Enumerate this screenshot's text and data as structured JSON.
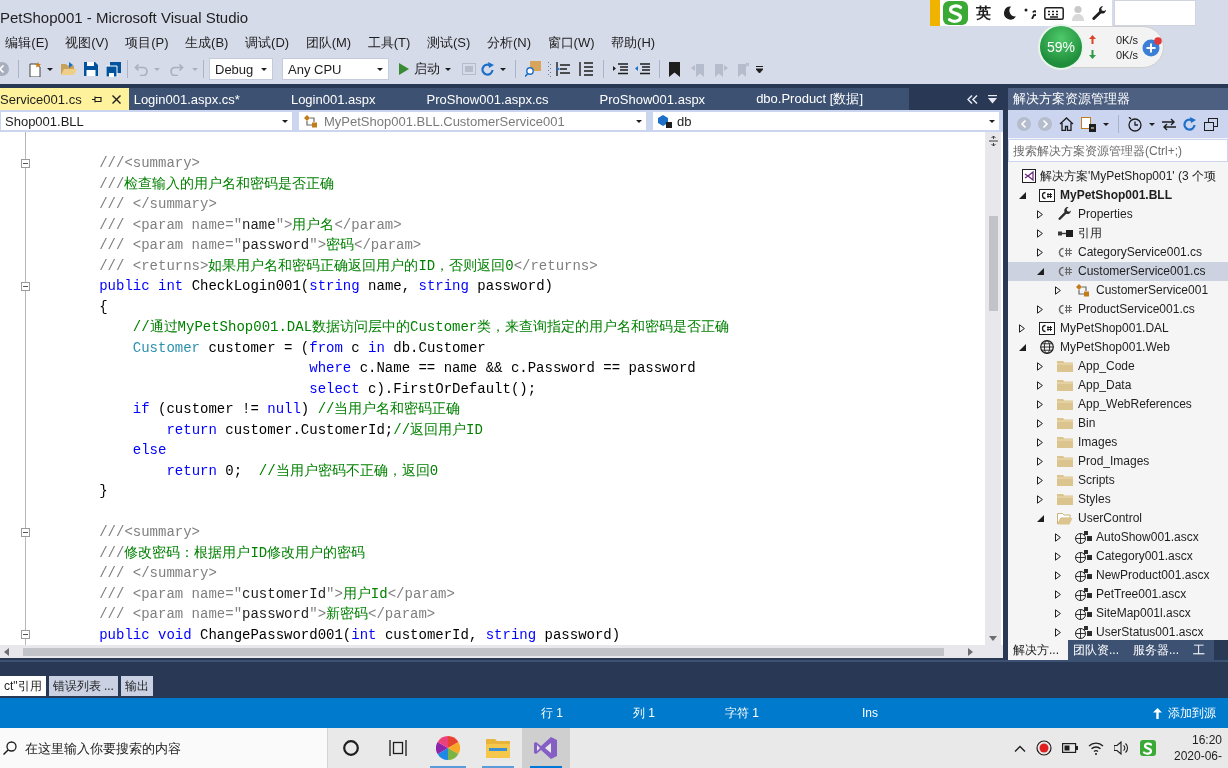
{
  "window": {
    "title": "PetShop001 - Microsoft Visual Studio"
  },
  "menu": [
    "编辑(E)",
    "视图(V)",
    "项目(P)",
    "生成(B)",
    "调试(D)",
    "团队(M)",
    "工具(T)",
    "测试(S)",
    "分析(N)",
    "窗口(W)",
    "帮助(H)"
  ],
  "toolbar": {
    "configuration": "Debug",
    "platform": "Any CPU",
    "start": "启动"
  },
  "ime_bar": {
    "mode": "英"
  },
  "net_monitor": {
    "usage": "59%",
    "upload": "0K/s",
    "download": "0K/s"
  },
  "document_tabs": [
    {
      "label": "Service001.cs",
      "selected": true
    },
    {
      "label": "Login001.aspx.cs*",
      "selected": false
    },
    {
      "label": "Login001.aspx",
      "selected": false
    },
    {
      "label": "ProShow001.aspx.cs",
      "selected": false
    },
    {
      "label": "ProShow001.aspx",
      "selected": false
    },
    {
      "label": "dbo.Product [数据]",
      "selected": false
    }
  ],
  "nav_bar": {
    "project": "Shop001.BLL",
    "type": "MyPetShop001.BLL.CustomerService001",
    "member": "db"
  },
  "code": {
    "lines": [
      {
        "fold": true,
        "tokens": [
          {
            "kind": "doc",
            "text": "        ///<summary>"
          }
        ]
      },
      {
        "fold": false,
        "tokens": [
          {
            "kind": "doc",
            "text": "        ///"
          },
          {
            "kind": "doc_text",
            "text": "检查输入的用户名和密码是否正确"
          }
        ]
      },
      {
        "fold": false,
        "tokens": [
          {
            "kind": "doc",
            "text": "        /// </summary>"
          }
        ]
      },
      {
        "fold": false,
        "tokens": [
          {
            "kind": "doc",
            "text": "        /// <param name=\""
          },
          {
            "kind": "doc_value",
            "text": "name"
          },
          {
            "kind": "doc",
            "text": "\">"
          },
          {
            "kind": "doc_text",
            "text": "用户名"
          },
          {
            "kind": "doc",
            "text": "</param>"
          }
        ]
      },
      {
        "fold": false,
        "tokens": [
          {
            "kind": "doc",
            "text": "        /// <param name=\""
          },
          {
            "kind": "doc_value",
            "text": "password"
          },
          {
            "kind": "doc",
            "text": "\">"
          },
          {
            "kind": "doc_text",
            "text": "密码"
          },
          {
            "kind": "doc",
            "text": "</param>"
          }
        ]
      },
      {
        "fold": false,
        "tokens": [
          {
            "kind": "doc",
            "text": "        /// <returns>"
          },
          {
            "kind": "doc_text",
            "text": "如果用户名和密码正确返回用户的ID，否则返回0"
          },
          {
            "kind": "doc",
            "text": "</returns>"
          }
        ]
      },
      {
        "fold": true,
        "tokens": [
          {
            "kind": "keyword",
            "text": "        public"
          },
          {
            "kind": "keyword",
            "text": " int"
          },
          {
            "kind": "plain",
            "text": " CheckLogin001("
          },
          {
            "kind": "keyword",
            "text": "string"
          },
          {
            "kind": "plain",
            "text": " name, "
          },
          {
            "kind": "keyword",
            "text": "string"
          },
          {
            "kind": "plain",
            "text": " password)"
          }
        ]
      },
      {
        "fold": false,
        "tokens": [
          {
            "kind": "plain",
            "text": "        {"
          }
        ]
      },
      {
        "fold": false,
        "tokens": [
          {
            "kind": "comment",
            "text": "            //通过MyPetShop001.DAL数据访问层中的Customer类，来查询指定的用户名和密码是否正确"
          }
        ]
      },
      {
        "fold": false,
        "tokens": [
          {
            "kind": "type",
            "text": "            Customer"
          },
          {
            "kind": "plain",
            "text": " customer = ("
          },
          {
            "kind": "keyword",
            "text": "from"
          },
          {
            "kind": "plain",
            "text": " c "
          },
          {
            "kind": "keyword",
            "text": "in"
          },
          {
            "kind": "plain",
            "text": " db.Customer"
          }
        ]
      },
      {
        "fold": false,
        "tokens": [
          {
            "kind": "keyword",
            "text": "                                 where"
          },
          {
            "kind": "plain",
            "text": " c.Name == name && c.Password == password"
          }
        ]
      },
      {
        "fold": false,
        "tokens": [
          {
            "kind": "keyword",
            "text": "                                 select"
          },
          {
            "kind": "plain",
            "text": " c).FirstOrDefault();"
          }
        ]
      },
      {
        "fold": false,
        "tokens": [
          {
            "kind": "keyword",
            "text": "            if"
          },
          {
            "kind": "plain",
            "text": " (customer != "
          },
          {
            "kind": "keyword",
            "text": "null"
          },
          {
            "kind": "plain",
            "text": ") "
          },
          {
            "kind": "comment",
            "text": "//当用户名和密码正确"
          }
        ]
      },
      {
        "fold": false,
        "tokens": [
          {
            "kind": "keyword",
            "text": "                return"
          },
          {
            "kind": "plain",
            "text": " customer.CustomerId;"
          },
          {
            "kind": "comment",
            "text": "//返回用户ID"
          }
        ]
      },
      {
        "fold": false,
        "tokens": [
          {
            "kind": "keyword",
            "text": "            else"
          }
        ]
      },
      {
        "fold": false,
        "tokens": [
          {
            "kind": "keyword",
            "text": "                return"
          },
          {
            "kind": "plain",
            "text": " 0;  "
          },
          {
            "kind": "comment",
            "text": "//当用户密码不正确，返回0"
          }
        ]
      },
      {
        "fold": false,
        "tokens": [
          {
            "kind": "plain",
            "text": "        }"
          }
        ]
      },
      {
        "fold": false
      },
      {
        "fold": true,
        "tokens": [
          {
            "kind": "doc",
            "text": "        ///<summary>"
          }
        ]
      },
      {
        "fold": false,
        "tokens": [
          {
            "kind": "doc",
            "text": "        ///"
          },
          {
            "kind": "doc_text",
            "text": "修改密码：根据用户ID修改用户的密码"
          }
        ]
      },
      {
        "fold": false,
        "tokens": [
          {
            "kind": "doc",
            "text": "        /// </summary>"
          }
        ]
      },
      {
        "fold": false,
        "tokens": [
          {
            "kind": "doc",
            "text": "        /// <param name=\""
          },
          {
            "kind": "doc_value",
            "text": "customerId"
          },
          {
            "kind": "doc",
            "text": "\">"
          },
          {
            "kind": "doc_text",
            "text": "用户Id"
          },
          {
            "kind": "doc",
            "text": "</param>"
          }
        ]
      },
      {
        "fold": false,
        "tokens": [
          {
            "kind": "doc",
            "text": "        /// <param name=\""
          },
          {
            "kind": "doc_value",
            "text": "password"
          },
          {
            "kind": "doc",
            "text": "\">"
          },
          {
            "kind": "doc_text",
            "text": "新密码"
          },
          {
            "kind": "doc",
            "text": "</param>"
          }
        ]
      },
      {
        "fold": true,
        "tokens": [
          {
            "kind": "keyword",
            "text": "        public"
          },
          {
            "kind": "keyword",
            "text": " void"
          },
          {
            "kind": "plain",
            "text": " ChangePassword001("
          },
          {
            "kind": "keyword",
            "text": "int"
          },
          {
            "kind": "plain",
            "text": " customerId, "
          },
          {
            "kind": "keyword",
            "text": "string"
          },
          {
            "kind": "plain",
            "text": " password)"
          }
        ]
      }
    ]
  },
  "solution_explorer": {
    "title": "解决方案资源管理器",
    "search": {
      "placeholder": "搜索解决方案资源管理器(Ctrl+;)"
    },
    "solution": "解决方案'MyPetShop001' (3 个项",
    "tree": [
      {
        "label": "MyPetShop001.BLL",
        "kind": "csproj",
        "startup": true,
        "expanded": true,
        "selected": false,
        "children": [
          {
            "label": "Properties",
            "kind": "properties",
            "expanded": false,
            "selected": false
          },
          {
            "label": "引用",
            "kind": "references",
            "expanded": false,
            "selected": false
          },
          {
            "label": "CategoryService001.cs",
            "kind": "csfile",
            "expanded": false,
            "selected": false
          },
          {
            "label": "CustomerService001.cs",
            "kind": "csfile",
            "expanded": true,
            "selected": true,
            "children": [
              {
                "label": "CustomerService001",
                "kind": "class",
                "expanded": false,
                "selected": false
              }
            ]
          },
          {
            "label": "ProductService001.cs",
            "kind": "csfile",
            "expanded": false,
            "selected": false
          }
        ]
      },
      {
        "label": "MyPetShop001.DAL",
        "kind": "csproj",
        "startup": false,
        "expanded": false,
        "selected": false
      },
      {
        "label": "MyPetShop001.Web",
        "kind": "webproj",
        "startup": false,
        "expanded": true,
        "selected": false,
        "children": [
          {
            "label": "App_Code",
            "kind": "folder",
            "expanded": false,
            "selected": false
          },
          {
            "label": "App_Data",
            "kind": "folder",
            "expanded": false,
            "selected": false
          },
          {
            "label": "App_WebReferences",
            "kind": "folder",
            "expanded": false,
            "selected": false
          },
          {
            "label": "Bin",
            "kind": "folder",
            "expanded": false,
            "selected": false
          },
          {
            "label": "Images",
            "kind": "folder",
            "expanded": false,
            "selected": false
          },
          {
            "label": "Prod_Images",
            "kind": "folder",
            "expanded": false,
            "selected": false
          },
          {
            "label": "Scripts",
            "kind": "folder",
            "expanded": false,
            "selected": false
          },
          {
            "label": "Styles",
            "kind": "folder",
            "expanded": false,
            "selected": false
          },
          {
            "label": "UserControl",
            "kind": "folder",
            "expanded": true,
            "selected": false,
            "children": [
              {
                "label": "AutoShow001.ascx",
                "kind": "usercontrol",
                "expanded": false,
                "selected": false
              },
              {
                "label": "Category001.ascx",
                "kind": "usercontrol",
                "expanded": false,
                "selected": false
              },
              {
                "label": "NewProduct001.ascx",
                "kind": "usercontrol",
                "expanded": false,
                "selected": false
              },
              {
                "label": "PetTree001.ascx",
                "kind": "usercontrol",
                "expanded": false,
                "selected": false
              },
              {
                "label": "SiteMap001l.ascx",
                "kind": "usercontrol",
                "expanded": false,
                "selected": false
              },
              {
                "label": "UserStatus001.ascx",
                "kind": "usercontrol",
                "expanded": false,
                "selected": false
              }
            ]
          }
        ]
      }
    ],
    "tabs": [
      {
        "label": "解决方...",
        "selected": true
      },
      {
        "label": "团队资...",
        "selected": false
      },
      {
        "label": "服务器...",
        "selected": false
      },
      {
        "label": "工",
        "selected": false
      }
    ]
  },
  "bottom_tabs": [
    {
      "label": "ct\"引用",
      "selected": true
    },
    {
      "label": "错误列表 ...",
      "selected": false
    },
    {
      "label": "输出",
      "selected": false
    }
  ],
  "status_bar": {
    "line": "行 1",
    "column": "列 1",
    "char": "字符 1",
    "mode": "Ins",
    "source_control": "添加到源"
  },
  "taskbar": {
    "search": {
      "placeholder": "在这里输入你要搜索的内容"
    },
    "apps": [
      {
        "kind": "paint",
        "running": true,
        "selected": false
      },
      {
        "kind": "explorer",
        "running": true,
        "selected": false
      },
      {
        "kind": "visual_studio",
        "running": true,
        "selected": true
      }
    ],
    "clock": {
      "time": "16:20",
      "date": "2020-06-"
    }
  }
}
